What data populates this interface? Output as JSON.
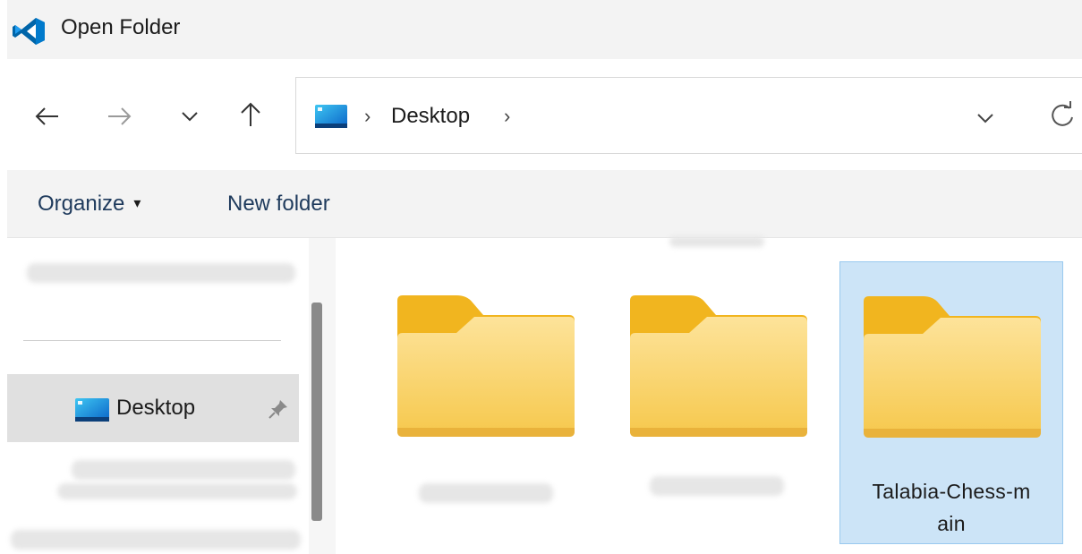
{
  "window": {
    "title": "Open Folder",
    "app_icon": "vscode-logo-icon"
  },
  "nav": {
    "back_icon": "arrow-left-icon",
    "forward_icon": "arrow-right-icon",
    "recent_icon": "chevron-down-icon",
    "up_icon": "arrow-up-icon"
  },
  "address": {
    "separator": "›",
    "location": "Desktop",
    "location_icon": "desktop-icon",
    "dropdown_icon": "chevron-down-icon",
    "refresh_icon": "refresh-icon"
  },
  "commands": {
    "organize_label": "Organize",
    "organize_caret": "▾",
    "new_folder_label": "New folder"
  },
  "sidebar": {
    "items": [
      {
        "label": "Desktop",
        "icon": "desktop-icon",
        "pinned": true,
        "selected": true
      }
    ]
  },
  "folders": [
    {
      "name": "",
      "selected": false,
      "name_redacted": true
    },
    {
      "name": "",
      "selected": false,
      "name_redacted": true
    },
    {
      "name": "Talabia-Chess-main",
      "name_line1": "Talabia-Chess-m",
      "name_line2": "ain",
      "selected": true
    }
  ],
  "colors": {
    "selection_bg": "#cce4f7",
    "selection_border": "#99c9ef",
    "folder_yellow": "#f8d775",
    "folder_tab": "#f0b429",
    "vscode_blue": "#0078d4"
  }
}
